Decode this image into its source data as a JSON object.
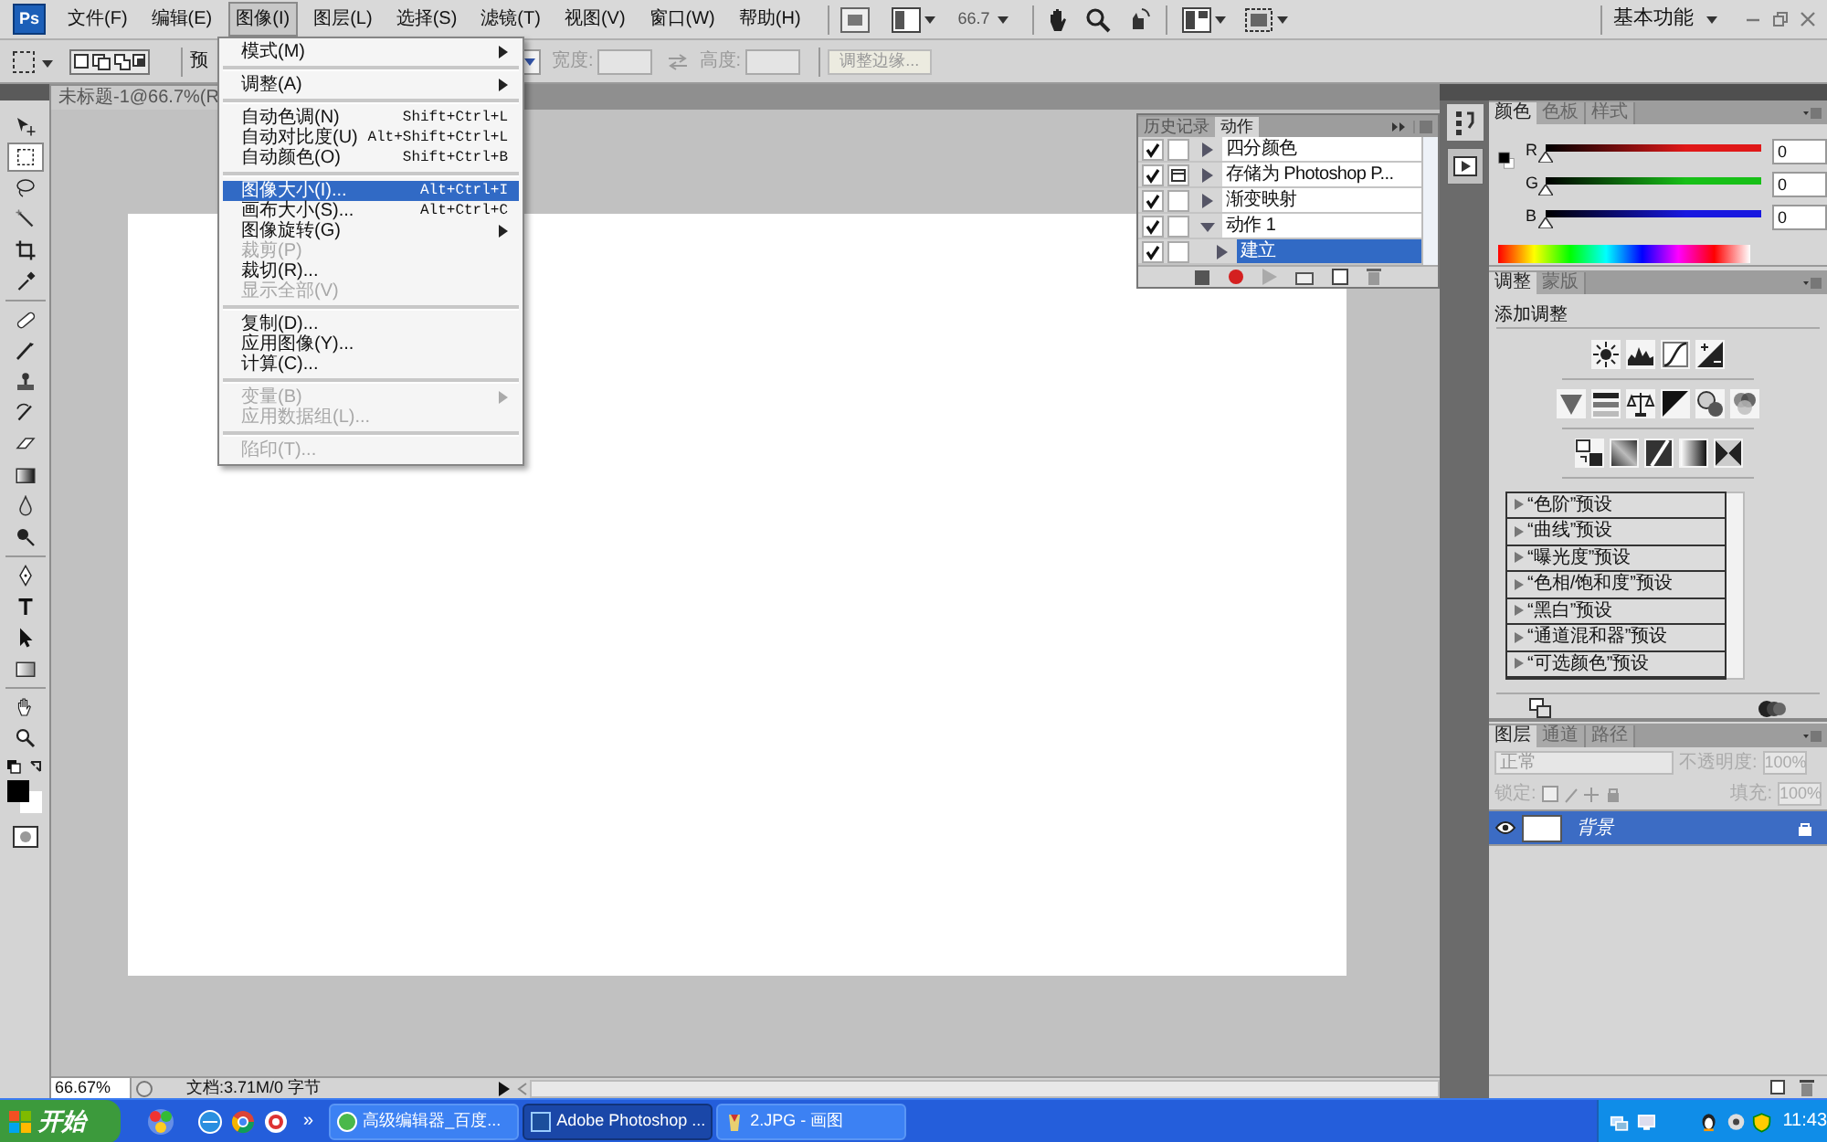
{
  "app": {
    "logo": "Ps"
  },
  "menubar": [
    {
      "label": "文件(F)",
      "selected": false
    },
    {
      "label": "编辑(E)",
      "selected": false
    },
    {
      "label": "图像(I)",
      "selected": true
    },
    {
      "label": "图层(L)",
      "selected": false
    },
    {
      "label": "选择(S)",
      "selected": false
    },
    {
      "label": "滤镜(T)",
      "selected": false
    },
    {
      "label": "视图(V)",
      "selected": false
    },
    {
      "label": "窗口(W)",
      "selected": false
    },
    {
      "label": "帮助(H)",
      "selected": false
    }
  ],
  "app_bar": {
    "zoom": "66.7",
    "workspace": "基本功能"
  },
  "options_bar": {
    "style_label": "预",
    "width_label": "宽度:",
    "height_label": "高度:",
    "refine_button": "调整边缘..."
  },
  "toolbox": {
    "tools": [
      {
        "selected": false
      },
      {
        "selected": true
      },
      {
        "selected": false
      },
      {
        "selected": false
      },
      {
        "selected": false
      },
      {
        "selected": false
      },
      {
        "selected": false
      },
      {
        "selected": false
      },
      {
        "selected": false
      },
      {
        "selected": false
      },
      {
        "selected": false
      },
      {
        "selected": false
      },
      {
        "selected": false
      },
      {
        "selected": false
      },
      {
        "selected": false
      },
      {
        "selected": false
      },
      {
        "selected": false
      },
      {
        "selected": false
      },
      {
        "selected": false
      },
      {
        "selected": false
      }
    ]
  },
  "document": {
    "tab": "未标题-1@66.7%(R"
  },
  "image_menu": {
    "items": [
      {
        "kind": "item",
        "label": "模式(M)",
        "submenu": true,
        "selected": false,
        "disabled": false
      },
      {
        "kind": "separator"
      },
      {
        "kind": "item",
        "label": "调整(A)",
        "submenu": true,
        "selected": false,
        "disabled": false
      },
      {
        "kind": "separator"
      },
      {
        "kind": "item",
        "label": "自动色调(N)",
        "shortcut": "Shift+Ctrl+L",
        "selected": false,
        "disabled": false
      },
      {
        "kind": "item",
        "label": "自动对比度(U)",
        "shortcut": "Alt+Shift+Ctrl+L",
        "selected": false,
        "disabled": false
      },
      {
        "kind": "item",
        "label": "自动颜色(O)",
        "shortcut": "Shift+Ctrl+B",
        "selected": false,
        "disabled": false
      },
      {
        "kind": "separator"
      },
      {
        "kind": "item",
        "label": "图像大小(I)...",
        "shortcut": "Alt+Ctrl+I",
        "selected": true,
        "disabled": false
      },
      {
        "kind": "item",
        "label": "画布大小(S)...",
        "shortcut": "Alt+Ctrl+C",
        "selected": false,
        "disabled": false
      },
      {
        "kind": "item",
        "label": "图像旋转(G)",
        "submenu": true,
        "selected": false,
        "disabled": false
      },
      {
        "kind": "item",
        "label": "裁剪(P)",
        "selected": false,
        "disabled": true
      },
      {
        "kind": "item",
        "label": "裁切(R)...",
        "selected": false,
        "disabled": false
      },
      {
        "kind": "item",
        "label": "显示全部(V)",
        "selected": false,
        "disabled": true
      },
      {
        "kind": "separator"
      },
      {
        "kind": "item",
        "label": "复制(D)...",
        "selected": false,
        "disabled": false
      },
      {
        "kind": "item",
        "label": "应用图像(Y)...",
        "selected": false,
        "disabled": false
      },
      {
        "kind": "item",
        "label": "计算(C)...",
        "selected": false,
        "disabled": false
      },
      {
        "kind": "separator"
      },
      {
        "kind": "item",
        "label": "变量(B)",
        "submenu": true,
        "selected": false,
        "disabled": true
      },
      {
        "kind": "item",
        "label": "应用数据组(L)...",
        "selected": false,
        "disabled": true
      },
      {
        "kind": "separator"
      },
      {
        "kind": "item",
        "label": "陷印(T)...",
        "selected": false,
        "disabled": true
      }
    ]
  },
  "actions_panel": {
    "tabs": [
      {
        "label": "历史记录",
        "selected": false
      },
      {
        "label": "动作",
        "selected": true
      }
    ],
    "rows": [
      {
        "label": "四分颜色",
        "checked": true,
        "dialog": false,
        "expanded": false,
        "selected": false
      },
      {
        "label": "存储为 Photoshop P...",
        "checked": true,
        "dialog": true,
        "expanded": false,
        "selected": false
      },
      {
        "label": "渐变映射",
        "checked": true,
        "dialog": false,
        "expanded": false,
        "selected": false
      },
      {
        "label": "动作 1",
        "checked": true,
        "dialog": false,
        "expanded": true,
        "selected": false,
        "children": [
          {
            "label": "建立",
            "checked": true,
            "dialog": false,
            "expanded": false,
            "selected": true
          }
        ]
      }
    ]
  },
  "color_panel": {
    "tabs": [
      {
        "label": "颜色",
        "selected": true
      },
      {
        "label": "色板",
        "selected": false
      },
      {
        "label": "样式",
        "selected": false
      }
    ],
    "channels": [
      {
        "label": "R",
        "value": "0",
        "level": 0,
        "color": "#e01818"
      },
      {
        "label": "G",
        "value": "0",
        "level": 0,
        "color": "#18c018"
      },
      {
        "label": "B",
        "value": "0",
        "level": 0,
        "color": "#1818e0"
      }
    ]
  },
  "adjustments_panel": {
    "tabs": [
      {
        "label": "调整",
        "selected": true
      },
      {
        "label": "蒙版",
        "selected": false
      }
    ],
    "title": "添加调整",
    "presets": [
      "“色阶”预设",
      "“曲线”预设",
      "“曝光度”预设",
      "“色相/饱和度”预设",
      "“黑白”预设",
      "“通道混和器”预设",
      "“可选颜色”预设"
    ]
  },
  "layers_panel": {
    "tabs": [
      {
        "label": "图层",
        "selected": true
      },
      {
        "label": "通道",
        "selected": false
      },
      {
        "label": "路径",
        "selected": false
      }
    ],
    "blend_mode": "正常",
    "opacity_label": "不透明度:",
    "opacity": "100%",
    "lock_label": "锁定:",
    "fill_label": "填充:",
    "fill": "100%",
    "layers": [
      {
        "name": "背景",
        "selected": true,
        "visible": true,
        "locked": true
      }
    ]
  },
  "status_bar": {
    "zoom": "66.67%",
    "info": "文档:3.71M/0 字节"
  },
  "taskbar": {
    "start": "开始",
    "quick_launch_more": "»",
    "tasks": [
      {
        "label": "高级编辑器_百度...",
        "selected": false
      },
      {
        "label": "Adobe Photoshop ...",
        "selected": true
      },
      {
        "label": "2.JPG - 画图",
        "selected": false
      }
    ],
    "clock": "11:43"
  }
}
